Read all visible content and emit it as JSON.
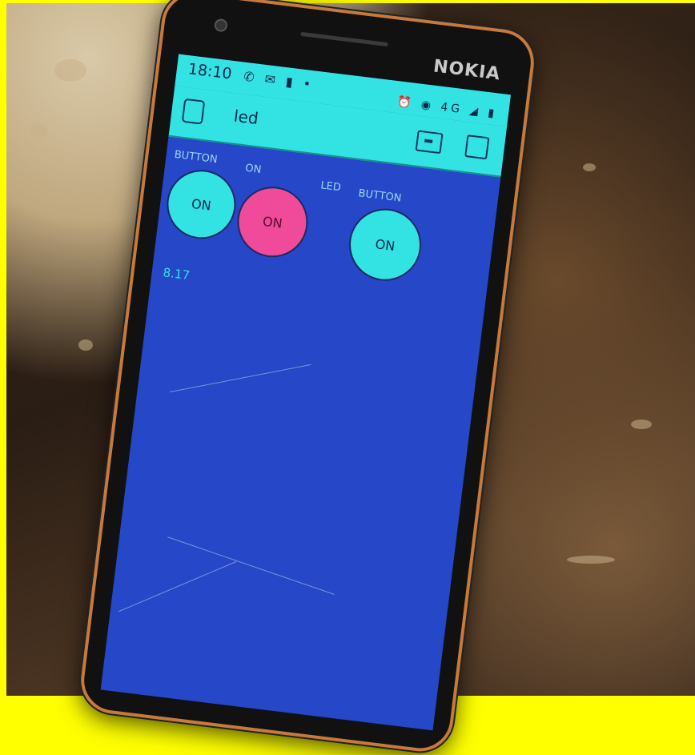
{
  "status_bar": {
    "time": "18:10",
    "left_icons": "✆ ✉ ▮ •",
    "right_icons": "⏰ ◉ 4G ◢ ▮"
  },
  "app_bar": {
    "title": "led"
  },
  "widgets": {
    "label_button_1": "BUTTON",
    "label_on": "ON",
    "label_led": "LED",
    "label_button_2": "BUTTON",
    "button_1_text": "ON",
    "led_text": "ON",
    "button_2_text": "ON",
    "value_display": "8.17"
  },
  "device": {
    "brand": "NOKIA"
  },
  "colors": {
    "accent": "#33e3e3",
    "screen_bg": "#2547c8",
    "led_on": "#f04a9a",
    "page_border": "#ffff00"
  }
}
